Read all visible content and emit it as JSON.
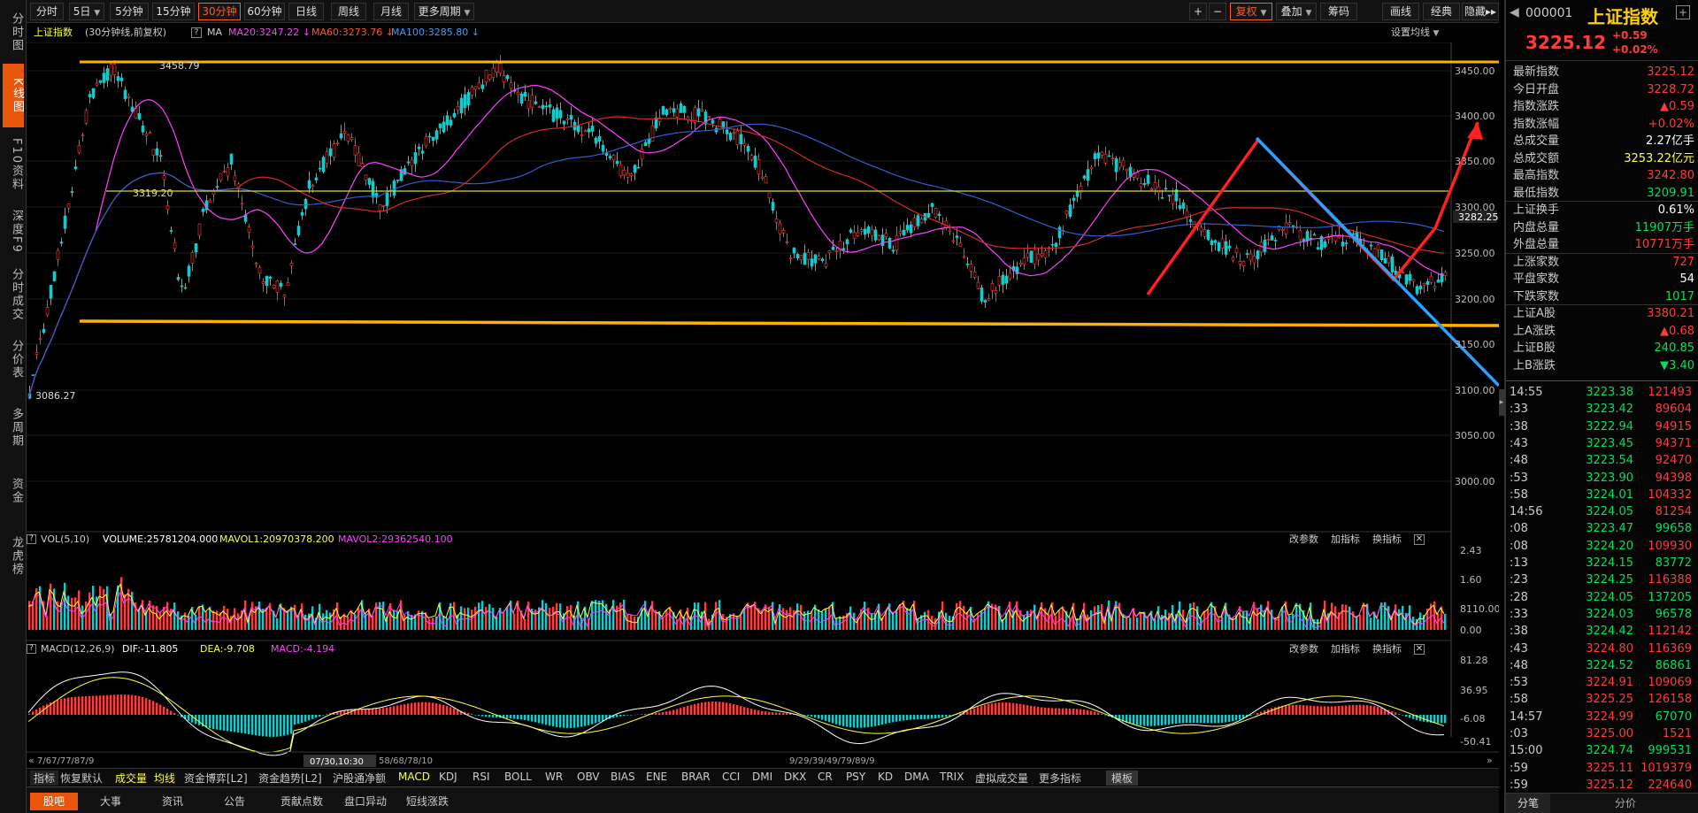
{
  "leftnav": [
    "分时图",
    "K线图",
    "F10资料",
    "深度F9",
    "分时成交",
    "分价表",
    "多周期",
    "资金",
    "龙虎榜"
  ],
  "topbar": {
    "periods": [
      "分时",
      "5日",
      "5分钟",
      "15分钟",
      "30分钟",
      "60分钟",
      "日线",
      "周线",
      "月线",
      "更多周期"
    ],
    "active_period": "30分钟",
    "right_buttons": [
      "+",
      "−",
      "复权",
      "叠加",
      "筹码",
      "画线",
      "经典",
      "隐藏"
    ]
  },
  "info": {
    "name": "上证指数",
    "period_text": "(30分钟线,前复权)",
    "ma_label": "MA",
    "ma20": "MA20:3247.22 ↓",
    "ma60": "MA60:3273.76 ↓",
    "ma100": "MA100:3285.80 ↓",
    "settings": "设置均线"
  },
  "price_axis": [
    "3450.00",
    "3400.00",
    "3350.00",
    "3300.00",
    "3250.00",
    "3200.00",
    "3150.00",
    "3100.00",
    "3050.00",
    "3000.00"
  ],
  "current_price_tag": "3282.25",
  "annotations": {
    "high": "3458.79",
    "low": "3086.27",
    "level": "3319.20"
  },
  "vol": {
    "label": "VOL(5,10)",
    "volume": "VOLUME:25781204.000",
    "mavol1": "MAVOL1:20970378.200",
    "mavol2": "MAVOL2:29362540.100",
    "axis": [
      "2.43",
      "1.60",
      "8110.00",
      "0.00"
    ]
  },
  "macd": {
    "label": "MACD(12,26,9)",
    "dif": "DIF:-11.805",
    "dea": "DEA:-9.708",
    "macd": "MACD:-4.194",
    "axis": [
      "81.28",
      "36.95",
      "-6.08",
      "-50.41"
    ]
  },
  "panel_actions": [
    "改参数",
    "加指标",
    "换指标"
  ],
  "timeline": {
    "left": "7/67/77/87/9",
    "cursor": "07/30,10:30",
    "mid": "58/68/78/10",
    "right": "9/29/39/49/79/89/9"
  },
  "indicator_tabs": [
    "指标",
    "恢复默认",
    "成交量",
    "均线",
    "资金博弈[L2]",
    "资金趋势[L2]",
    "沪股通净额",
    "MACD",
    "KDJ",
    "RSI",
    "BOLL",
    "WR",
    "OBV",
    "BIAS",
    "ENE",
    "BRAR",
    "CCI",
    "DMI",
    "DKX",
    "CR",
    "PSY",
    "KD",
    "DMA",
    "TRIX",
    "虚拟成交量",
    "更多指标",
    "模板"
  ],
  "bottom_tabs": [
    "股吧",
    "大事",
    "资讯",
    "公告",
    "贡献点数",
    "盘口异动",
    "短线涨跌"
  ],
  "right": {
    "code": "000001",
    "name": "上证指数",
    "price": "3225.12",
    "change": "+0.59",
    "change_pct": "+0.02%",
    "stats": [
      {
        "label": "最新指数",
        "value": "3225.12",
        "color": "red"
      },
      {
        "label": "今日开盘",
        "value": "3228.72",
        "color": "red"
      },
      {
        "label": "指数涨跌",
        "value": "▲0.59",
        "color": "red"
      },
      {
        "label": "指数涨幅",
        "value": "+0.02%",
        "color": "red"
      },
      {
        "label": "总成交量",
        "value": "2.27亿手",
        "color": "white"
      },
      {
        "label": "总成交额",
        "value": "3253.22亿元",
        "color": "yellow"
      },
      {
        "label": "最高指数",
        "value": "3242.80",
        "color": "red"
      },
      {
        "label": "最低指数",
        "value": "3209.91",
        "color": "green"
      },
      {
        "label": "上证换手",
        "value": "0.61%",
        "color": "white"
      },
      {
        "label": "内盘总量",
        "value": "11907万手",
        "color": "green"
      },
      {
        "label": "外盘总量",
        "value": "10771万手",
        "color": "red"
      },
      {
        "label": "上涨家数",
        "value": "727",
        "color": "red"
      },
      {
        "label": "平盘家数",
        "value": "54",
        "color": "white"
      },
      {
        "label": "下跌家数",
        "value": "1017",
        "color": "green"
      },
      {
        "label": "上证A股",
        "value": "3380.21",
        "color": "red"
      },
      {
        "label": "上A涨跌",
        "value": "▲0.68",
        "color": "red"
      },
      {
        "label": "上证B股",
        "value": "240.85",
        "color": "green"
      },
      {
        "label": "上B涨跌",
        "value": "▼3.40",
        "color": "green"
      }
    ],
    "ticks": [
      {
        "t": "14:55",
        "p": "3223.38",
        "v": "121493",
        "pc": "green",
        "vc": "red"
      },
      {
        "t": ":33",
        "p": "3223.42",
        "v": "89604",
        "pc": "green",
        "vc": "red"
      },
      {
        "t": ":38",
        "p": "3222.94",
        "v": "94915",
        "pc": "green",
        "vc": "red"
      },
      {
        "t": ":43",
        "p": "3223.45",
        "v": "94371",
        "pc": "green",
        "vc": "red"
      },
      {
        "t": ":48",
        "p": "3223.54",
        "v": "92470",
        "pc": "green",
        "vc": "red"
      },
      {
        "t": ":53",
        "p": "3223.90",
        "v": "94398",
        "pc": "green",
        "vc": "red"
      },
      {
        "t": ":58",
        "p": "3224.01",
        "v": "104332",
        "pc": "green",
        "vc": "red"
      },
      {
        "t": "14:56",
        "p": "3224.05",
        "v": "81254",
        "pc": "green",
        "vc": "red"
      },
      {
        "t": ":08",
        "p": "3223.47",
        "v": "99658",
        "pc": "green",
        "vc": "green"
      },
      {
        "t": ":08",
        "p": "3224.20",
        "v": "109930",
        "pc": "green",
        "vc": "red"
      },
      {
        "t": ":13",
        "p": "3224.15",
        "v": "83772",
        "pc": "green",
        "vc": "green"
      },
      {
        "t": ":23",
        "p": "3224.25",
        "v": "116388",
        "pc": "green",
        "vc": "red"
      },
      {
        "t": ":28",
        "p": "3224.05",
        "v": "137205",
        "pc": "green",
        "vc": "green"
      },
      {
        "t": ":33",
        "p": "3224.03",
        "v": "96578",
        "pc": "green",
        "vc": "green"
      },
      {
        "t": ":38",
        "p": "3224.42",
        "v": "112142",
        "pc": "green",
        "vc": "red"
      },
      {
        "t": ":43",
        "p": "3224.80",
        "v": "116369",
        "pc": "red",
        "vc": "red"
      },
      {
        "t": ":48",
        "p": "3224.52",
        "v": "86861",
        "pc": "green",
        "vc": "green"
      },
      {
        "t": ":53",
        "p": "3224.91",
        "v": "109069",
        "pc": "red",
        "vc": "red"
      },
      {
        "t": ":58",
        "p": "3225.25",
        "v": "126158",
        "pc": "red",
        "vc": "red"
      },
      {
        "t": "14:57",
        "p": "3224.99",
        "v": "67070",
        "pc": "red",
        "vc": "green"
      },
      {
        "t": ":03",
        "p": "3225.00",
        "v": "1521",
        "pc": "red",
        "vc": "red"
      },
      {
        "t": "15:00",
        "p": "3224.74",
        "v": "999531",
        "pc": "green",
        "vc": "green"
      },
      {
        "t": ":59",
        "p": "3225.11",
        "v": "1019379",
        "pc": "red",
        "vc": "red"
      },
      {
        "t": ":59",
        "p": "3225.12",
        "v": "224640",
        "pc": "red",
        "vc": "red"
      }
    ],
    "bottom_tabs": [
      "分笔",
      "分价"
    ]
  },
  "colors": {
    "accent": "#e8560b",
    "red": "#ff3b3b",
    "green": "#00e05a",
    "yellow": "#ffff40",
    "magenta": "#ff40ff",
    "blue": "#3aa0ff",
    "orange": "#ffb000"
  }
}
